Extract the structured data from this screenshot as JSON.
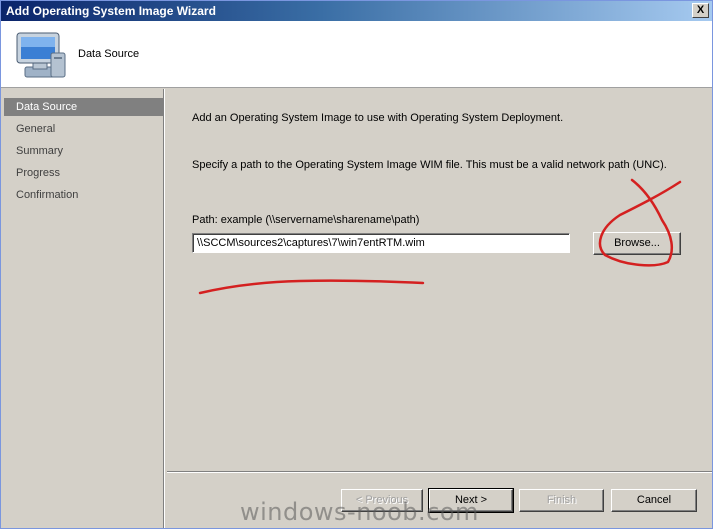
{
  "window": {
    "title": "Add Operating System Image Wizard",
    "close_symbol": "X"
  },
  "header": {
    "title": "Data Source",
    "icon": "computer-monitor-icon"
  },
  "sidebar": {
    "items": [
      {
        "label": "Data Source",
        "active": true
      },
      {
        "label": "General",
        "active": false
      },
      {
        "label": "Summary",
        "active": false
      },
      {
        "label": "Progress",
        "active": false
      },
      {
        "label": "Confirmation",
        "active": false
      }
    ]
  },
  "main": {
    "intro": "Add an Operating System Image to use with Operating System Deployment.",
    "spec": "Specify a path to the Operating System Image WIM file. This must be a valid network path (UNC).",
    "path_label": "Path: example (\\\\servername\\sharename\\path)",
    "path_value": "\\\\SCCM\\sources2\\captures\\7\\win7entRTM.wim",
    "browse_label": "Browse..."
  },
  "footer": {
    "previous_label": "< Previous",
    "next_label": "Next >",
    "finish_label": "Finish",
    "cancel_label": "Cancel"
  },
  "watermark": "windows-noob.com",
  "colors": {
    "title_start": "#0a246a",
    "title_end": "#a6caf0",
    "annotation": "#d42020",
    "face": "#d4d0c8"
  }
}
